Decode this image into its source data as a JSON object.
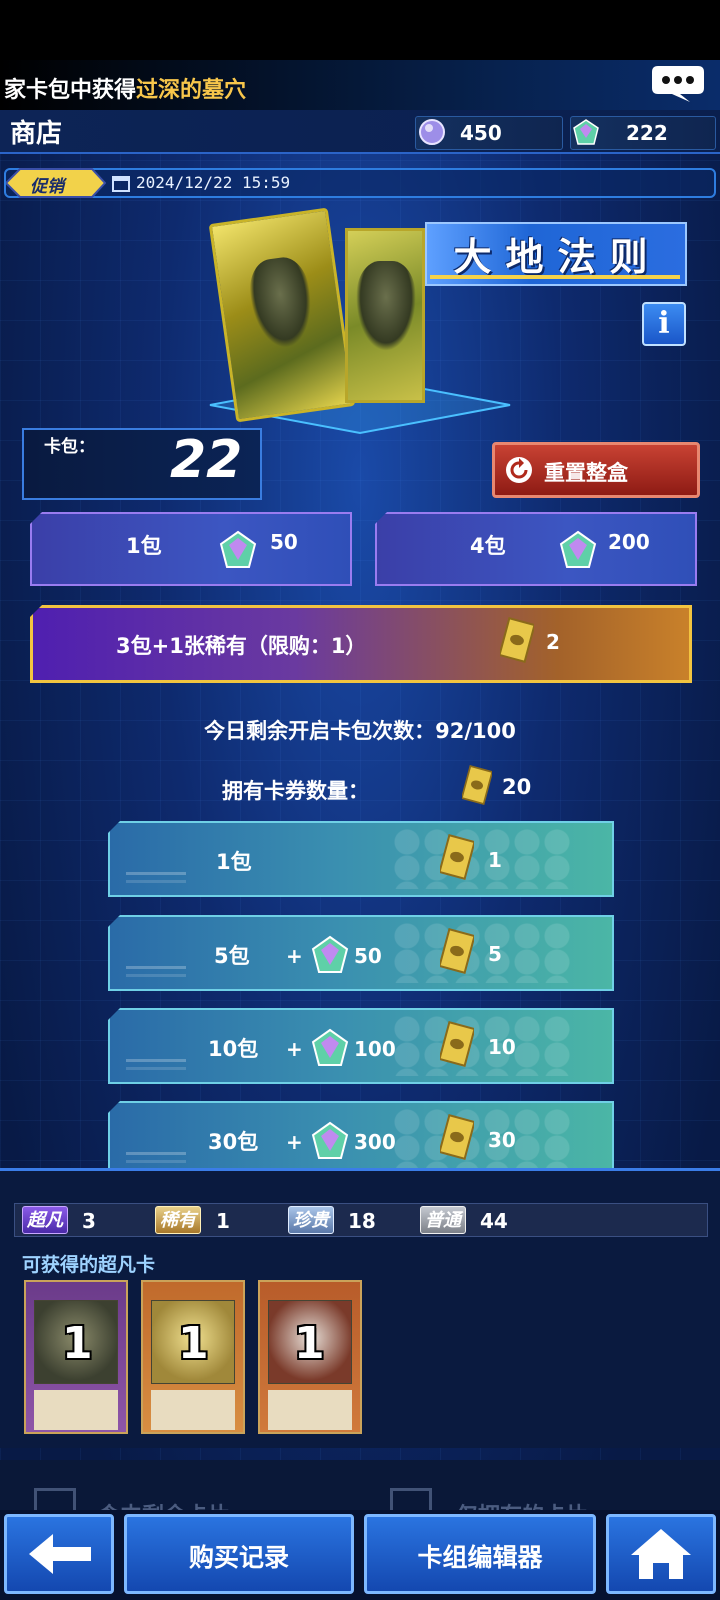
{
  "notice": {
    "prefix": "家卡包中获得",
    "highlight": "过深的墓穴"
  },
  "header": {
    "title": "商店",
    "currency_1": "450",
    "currency_2": "222"
  },
  "promo": {
    "tag": "促销",
    "date": "2024/12/22 15:59"
  },
  "pack": {
    "title": "大地法则",
    "count_label": "卡包：",
    "count_value": "22",
    "reset_label": "重置整盒"
  },
  "gem_purchases": [
    {
      "label": "1包",
      "cost": "50"
    },
    {
      "label": "4包",
      "cost": "200"
    }
  ],
  "special_purchase": {
    "label": "3包+1张稀有（限购：1）",
    "cost": "2"
  },
  "remaining_opens": "今日剩余开启卡包次数：92/100",
  "coupons": {
    "label": "拥有卡券数量：",
    "value": "20"
  },
  "ticket_purchases": [
    {
      "label": "1包",
      "plus": "",
      "gem_cost": "",
      "ticket_cost": "1"
    },
    {
      "label": "5包",
      "plus": "+",
      "gem_cost": "50",
      "ticket_cost": "5"
    },
    {
      "label": "10包",
      "plus": "+",
      "gem_cost": "100",
      "ticket_cost": "10"
    },
    {
      "label": "30包",
      "plus": "+",
      "gem_cost": "300",
      "ticket_cost": "30"
    }
  ],
  "rarity": {
    "ur_label": "超凡",
    "ur_count": "3",
    "sr_label": "稀有",
    "sr_count": "1",
    "r_label": "珍贵",
    "r_count": "18",
    "n_label": "普通",
    "n_count": "44"
  },
  "obtainable": {
    "title": "可获得的超凡卡",
    "cards": [
      {
        "count": "1",
        "icon": "earth-fiend-card"
      },
      {
        "count": "1",
        "icon": "gold-dragon-card"
      },
      {
        "count": "1",
        "icon": "winged-warrior-card"
      }
    ]
  },
  "filters": {
    "left": "含中剩余卡片",
    "right": "仅拥有的卡片"
  },
  "nav": {
    "history": "购买记录",
    "deck_editor": "卡组编辑器"
  },
  "colors": {
    "accent": "#2b64c8",
    "highlight": "#f7c64b",
    "reset": "#c84233"
  }
}
